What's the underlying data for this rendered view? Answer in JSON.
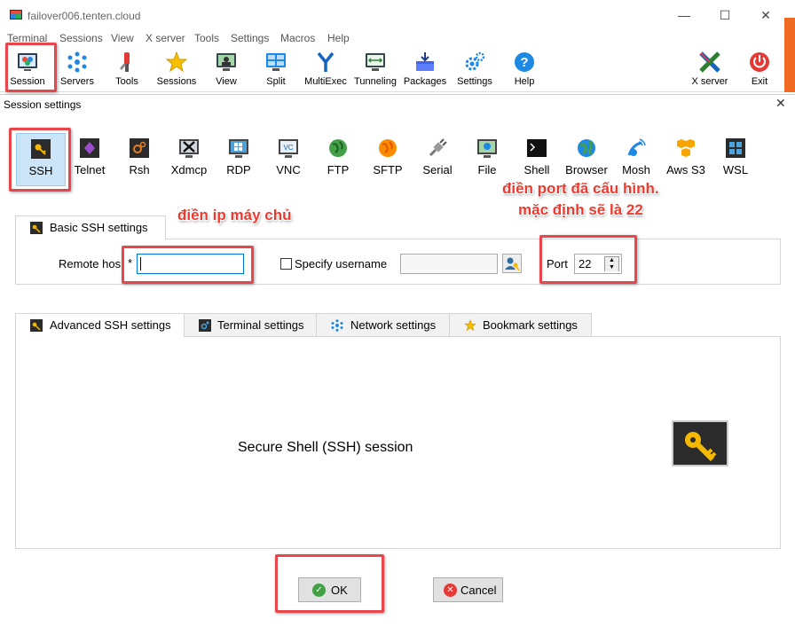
{
  "window": {
    "title": "failover006.tenten.cloud",
    "minimize": "—",
    "maximize": "☐",
    "close": "✕"
  },
  "menu": [
    "Terminal",
    "Sessions",
    "View",
    "X server",
    "Tools",
    "Settings",
    "Macros",
    "Help"
  ],
  "toolbar": {
    "left": [
      {
        "label": "Session",
        "icon": "session-icon"
      },
      {
        "label": "Servers",
        "icon": "servers-icon"
      },
      {
        "label": "Tools",
        "icon": "tools-icon"
      },
      {
        "label": "Sessions",
        "icon": "star-icon"
      },
      {
        "label": "View",
        "icon": "view-icon"
      },
      {
        "label": "Split",
        "icon": "split-icon"
      },
      {
        "label": "MultiExec",
        "icon": "multiexec-icon"
      },
      {
        "label": "Tunneling",
        "icon": "tunneling-icon"
      },
      {
        "label": "Packages",
        "icon": "packages-icon"
      },
      {
        "label": "Settings",
        "icon": "settings-icon"
      },
      {
        "label": "Help",
        "icon": "help-icon"
      }
    ],
    "right": [
      {
        "label": "X server",
        "icon": "xserver-icon"
      },
      {
        "label": "Exit",
        "icon": "exit-icon"
      }
    ]
  },
  "dialog": {
    "title": "Session settings",
    "close": "✕",
    "session_types": [
      "SSH",
      "Telnet",
      "Rsh",
      "Xdmcp",
      "RDP",
      "VNC",
      "FTP",
      "SFTP",
      "Serial",
      "File",
      "Shell",
      "Browser",
      "Mosh",
      "Aws S3",
      "WSL"
    ],
    "selected_type": "SSH",
    "basic_tab": "Basic SSH settings",
    "remote_host_label": "Remote hos",
    "remote_host_required": "*",
    "remote_host_value": "",
    "specify_username_label": "Specify username",
    "username_value": "",
    "port_label": "Port",
    "port_value": "22",
    "adv_tabs": [
      "Advanced SSH settings",
      "Terminal settings",
      "Network settings",
      "Bookmark settings"
    ],
    "session_description": "Secure Shell (SSH) session",
    "ok_label": "OK",
    "cancel_label": "Cancel"
  },
  "annotations": {
    "ip_note": "điền ip máy chủ",
    "port_note_line1": "điền port đã cấu hình.",
    "port_note_line2": "mặc định sẽ là 22"
  },
  "colors": {
    "annotation_red": "#e8464a",
    "selected_bg": "#cce4f7",
    "accent_orange": "#f06b21"
  }
}
